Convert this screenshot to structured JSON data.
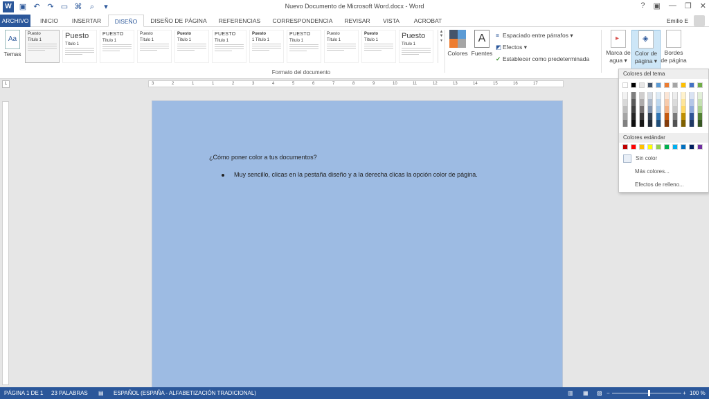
{
  "window": {
    "title": "Nuevo Documento de Microsoft Word.docx - Word",
    "controls": [
      "?",
      "▣",
      "—",
      "❐",
      "✕"
    ]
  },
  "quick_access": {
    "icons": [
      "word-logo",
      "save-icon",
      "undo-icon",
      "redo-icon",
      "open-icon",
      "format-painter-icon",
      "print-preview-icon",
      "customize-icon"
    ],
    "logo_letter": "W"
  },
  "tabs": [
    {
      "label": "ARCHIVO"
    },
    {
      "label": "INICIO"
    },
    {
      "label": "INSERTAR"
    },
    {
      "label": "DISEÑO"
    },
    {
      "label": "DISEÑO DE PÁGINA"
    },
    {
      "label": "REFERENCIAS"
    },
    {
      "label": "CORRESPONDENCIA"
    },
    {
      "label": "REVISAR"
    },
    {
      "label": "VISTA"
    },
    {
      "label": "ACROBAT"
    }
  ],
  "user": "Emilio E",
  "ribbon": {
    "temas_label": "Temas",
    "group_label": "Formato del documento",
    "styles": [
      {
        "title": "Puesto",
        "heading": "Título 1",
        "kind": "small"
      },
      {
        "title": "Puesto",
        "heading": "Título 1",
        "kind": "big"
      },
      {
        "title": "PUESTO",
        "heading": "Título 1",
        "kind": "caps"
      },
      {
        "title": "Puesto",
        "heading": "Título 1",
        "kind": "small"
      },
      {
        "title": "Puesto",
        "heading": "Título 1",
        "kind": "bold"
      },
      {
        "title": "PUESTO",
        "heading": "Título 1",
        "kind": "caps"
      },
      {
        "title": "Puesto",
        "heading": "1 Título 1",
        "kind": "bold"
      },
      {
        "title": "PUESTO",
        "heading": "Título 1",
        "kind": "caps"
      },
      {
        "title": "Puesto",
        "heading": "Título 1",
        "kind": "small"
      },
      {
        "title": "Puesto",
        "heading": "Título 1",
        "kind": "bold"
      },
      {
        "title": "Puesto",
        "heading": "Título 1",
        "kind": "big"
      }
    ],
    "colores": "Colores",
    "fuentes": "Fuentes",
    "fuentes_letter": "A",
    "espaciado": "Espaciado entre párrafos",
    "efectos": "Efectos",
    "predeterminada": "Establecer como predeterminada",
    "marca_agua": [
      "Marca de",
      "agua ▾"
    ],
    "color_pagina": [
      "Color de",
      "página ▾"
    ],
    "bordes_pagina": [
      "Bordes",
      "de página"
    ]
  },
  "ruler_marks": [
    "3",
    "2",
    "1",
    "1",
    "2",
    "3",
    "4",
    "5",
    "6",
    "7",
    "8",
    "9",
    "10",
    "11",
    "12",
    "13",
    "14",
    "15",
    "16",
    "17"
  ],
  "document": {
    "line1": "¿Cómo poner color a tus documentos?",
    "bullet": "Muy sencillo, clicas en la pestaña diseño y a la derecha clicas la opción color de página.",
    "page_color": "#9dbbe3"
  },
  "color_menu": {
    "theme_header": "Colores del tema",
    "standard_header": "Colores estándar",
    "no_color": "Sin color",
    "more_colors": "Más colores...",
    "fill_effects": "Efectos de relleno...",
    "theme_colors": [
      "#ffffff",
      "#000000",
      "#e7e6e6",
      "#44546a",
      "#5b9bd5",
      "#ed7d31",
      "#a5a5a5",
      "#ffc000",
      "#4472c4",
      "#70ad47"
    ],
    "theme_shades": [
      [
        "#f2f2f2",
        "#d9d9d9",
        "#bfbfbf",
        "#a6a6a6",
        "#808080"
      ],
      [
        "#7f7f7f",
        "#595959",
        "#404040",
        "#262626",
        "#0d0d0d"
      ],
      [
        "#d0cece",
        "#aeabab",
        "#757070",
        "#3a3838",
        "#171616"
      ],
      [
        "#d6dce4",
        "#adb9ca",
        "#8496b0",
        "#323f4f",
        "#222a35"
      ],
      [
        "#deebf6",
        "#bdd7ee",
        "#9dc3e6",
        "#2e75b5",
        "#1f4e79"
      ],
      [
        "#fbe5d5",
        "#f7cbac",
        "#f4b183",
        "#c55a11",
        "#833c0b"
      ],
      [
        "#ededed",
        "#dbdbdb",
        "#c9c9c9",
        "#7b7b7b",
        "#525252"
      ],
      [
        "#fff2cc",
        "#fee599",
        "#ffd965",
        "#bf9000",
        "#7f6000"
      ],
      [
        "#dae3f3",
        "#b4c6e7",
        "#8eaadb",
        "#2f5496",
        "#1f3864"
      ],
      [
        "#e2efd9",
        "#c5e0b3",
        "#a8d08d",
        "#538135",
        "#375623"
      ]
    ],
    "standard_colors": [
      "#c00000",
      "#ff0000",
      "#ffc000",
      "#ffff00",
      "#92d050",
      "#00b050",
      "#00b0f0",
      "#0070c0",
      "#002060",
      "#7030a0"
    ]
  },
  "status": {
    "page": "PÁGINA 1 DE 1",
    "words": "23 PALABRAS",
    "language": "ESPAÑOL (ESPAÑA - ALFABETIZACIÓN TRADICIONAL)",
    "zoom": "100 %",
    "zoom_level_percent": 100
  }
}
